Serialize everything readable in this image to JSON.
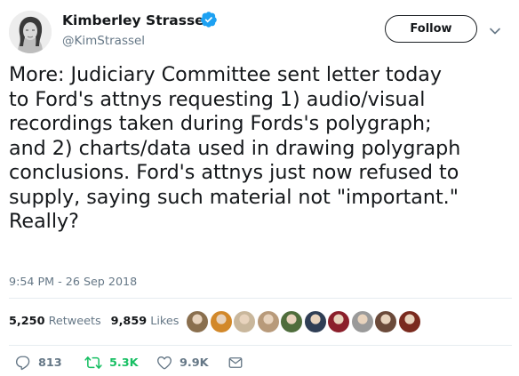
{
  "author": {
    "display_name": "Kimberley Strassel",
    "handle": "@KimStrassel",
    "verified": true
  },
  "header": {
    "follow_label": "Follow"
  },
  "tweet": {
    "text": "More: Judiciary Committee sent letter today\nto Ford's attnys requesting 1) audio/visual\nrecordings taken during Fords's polygraph;\nand 2) charts/data used in drawing polygraph\nconclusions. Ford's attnys just now refused to\nsupply, saying such material not \"important.\"\nReally?",
    "timestamp": "9:54 PM - 26 Sep 2018"
  },
  "stats": {
    "retweets_count": "5,250",
    "retweets_label": "Retweets",
    "likes_count": "9,859",
    "likes_label": "Likes"
  },
  "likers": [
    {
      "name": "liker-avatar-1",
      "color": "#8a6f4e"
    },
    {
      "name": "liker-avatar-2",
      "color": "#d2882a"
    },
    {
      "name": "liker-avatar-3",
      "color": "#c9b79c"
    },
    {
      "name": "liker-avatar-4",
      "color": "#b89a7a"
    },
    {
      "name": "liker-avatar-5",
      "color": "#4f6d3c"
    },
    {
      "name": "liker-avatar-6",
      "color": "#2f3e55"
    },
    {
      "name": "liker-avatar-7",
      "color": "#8b1f2b"
    },
    {
      "name": "liker-avatar-8",
      "color": "#9a9a9a"
    },
    {
      "name": "liker-avatar-9",
      "color": "#6b4a3a"
    },
    {
      "name": "liker-avatar-10",
      "color": "#7a2a1e"
    }
  ],
  "actions": {
    "replies": "813",
    "retweets": "5.3K",
    "likes": "9.9K"
  },
  "colors": {
    "verified_blue": "#1da1f2",
    "retweet_green": "#17bf63",
    "secondary_gray": "#657786"
  },
  "icons": {
    "verified": "verified-badge-icon",
    "caret": "chevron-down-icon",
    "reply": "reply-icon",
    "retweet": "retweet-icon",
    "like": "heart-icon",
    "dm": "envelope-icon"
  }
}
